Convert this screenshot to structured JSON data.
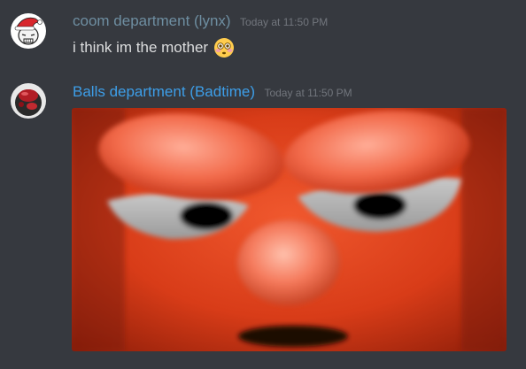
{
  "colors": {
    "background": "#36393f",
    "user1_name": "#6e8ea1",
    "user2_name": "#3d9ee8",
    "timestamp": "#72767d",
    "message_text": "#dcddde"
  },
  "messages": [
    {
      "username": "coom department (lynx)",
      "timestamp": "Today at 11:50 PM",
      "text": "i think im the mother",
      "emoji": "flushed-face"
    },
    {
      "username": "Balls department (Badtime)",
      "timestamp": "Today at 11:50 PM",
      "attachment": "image"
    }
  ]
}
